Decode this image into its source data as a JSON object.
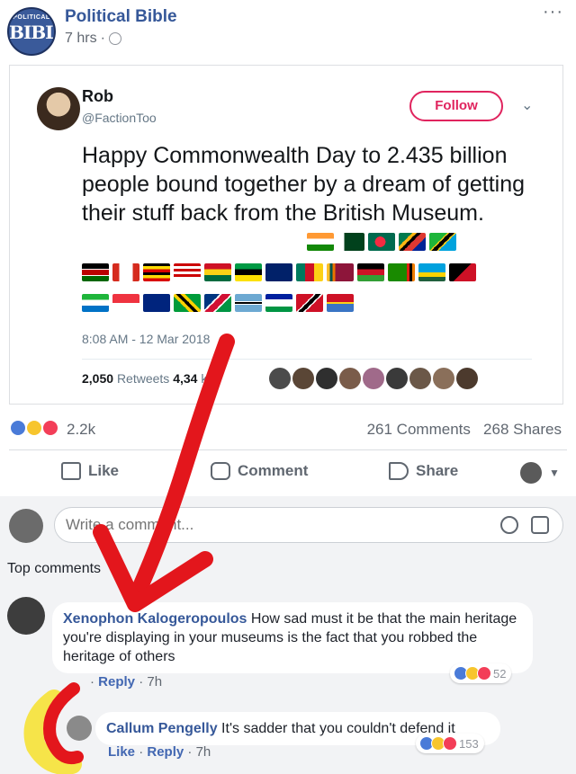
{
  "post": {
    "page_avatar_top": "POLITICAL",
    "page_avatar_main": "BIBLE",
    "page_name": "Political Bible",
    "time": "7 hrs",
    "more": "···"
  },
  "tweet": {
    "name": "Rob",
    "handle": "@FactionToo",
    "follow_label": "Follow",
    "text": "Happy Commonwealth Day to 2.435 billion people bound together by a dream of getting their stuff back from the British Museum.",
    "datetime": "8:08 AM - 12 Mar 2018",
    "retweets_count": "2,050",
    "retweets_label": "Retweets",
    "likes_count": "4,34",
    "likes_label": "kes"
  },
  "reactions": {
    "count": "2.2k",
    "comments": "261 Comments",
    "shares": "268 Shares",
    "colors": {
      "like": "#4a7bd8",
      "haha": "#f7c52d",
      "love": "#f33e58"
    }
  },
  "actions": {
    "like": "Like",
    "comment": "Comment",
    "share": "Share"
  },
  "comment_input": {
    "placeholder": "Write a comment..."
  },
  "top_comments_label": "Top comments",
  "comments": [
    {
      "author": "Xenophon Kalogeropoulos",
      "text": "How sad must it be that the main heritage you're displaying in your museums is the fact that you robbed the heritage of others",
      "meta_dot": "·",
      "reply": "Reply",
      "time": "7h",
      "reactions": "52"
    },
    {
      "author": "Callum Pengelly",
      "text": "It's sadder that you couldn't defend it",
      "like": "Like",
      "sep": "·",
      "reply": "Reply",
      "time": "7h",
      "reactions": "153"
    }
  ]
}
